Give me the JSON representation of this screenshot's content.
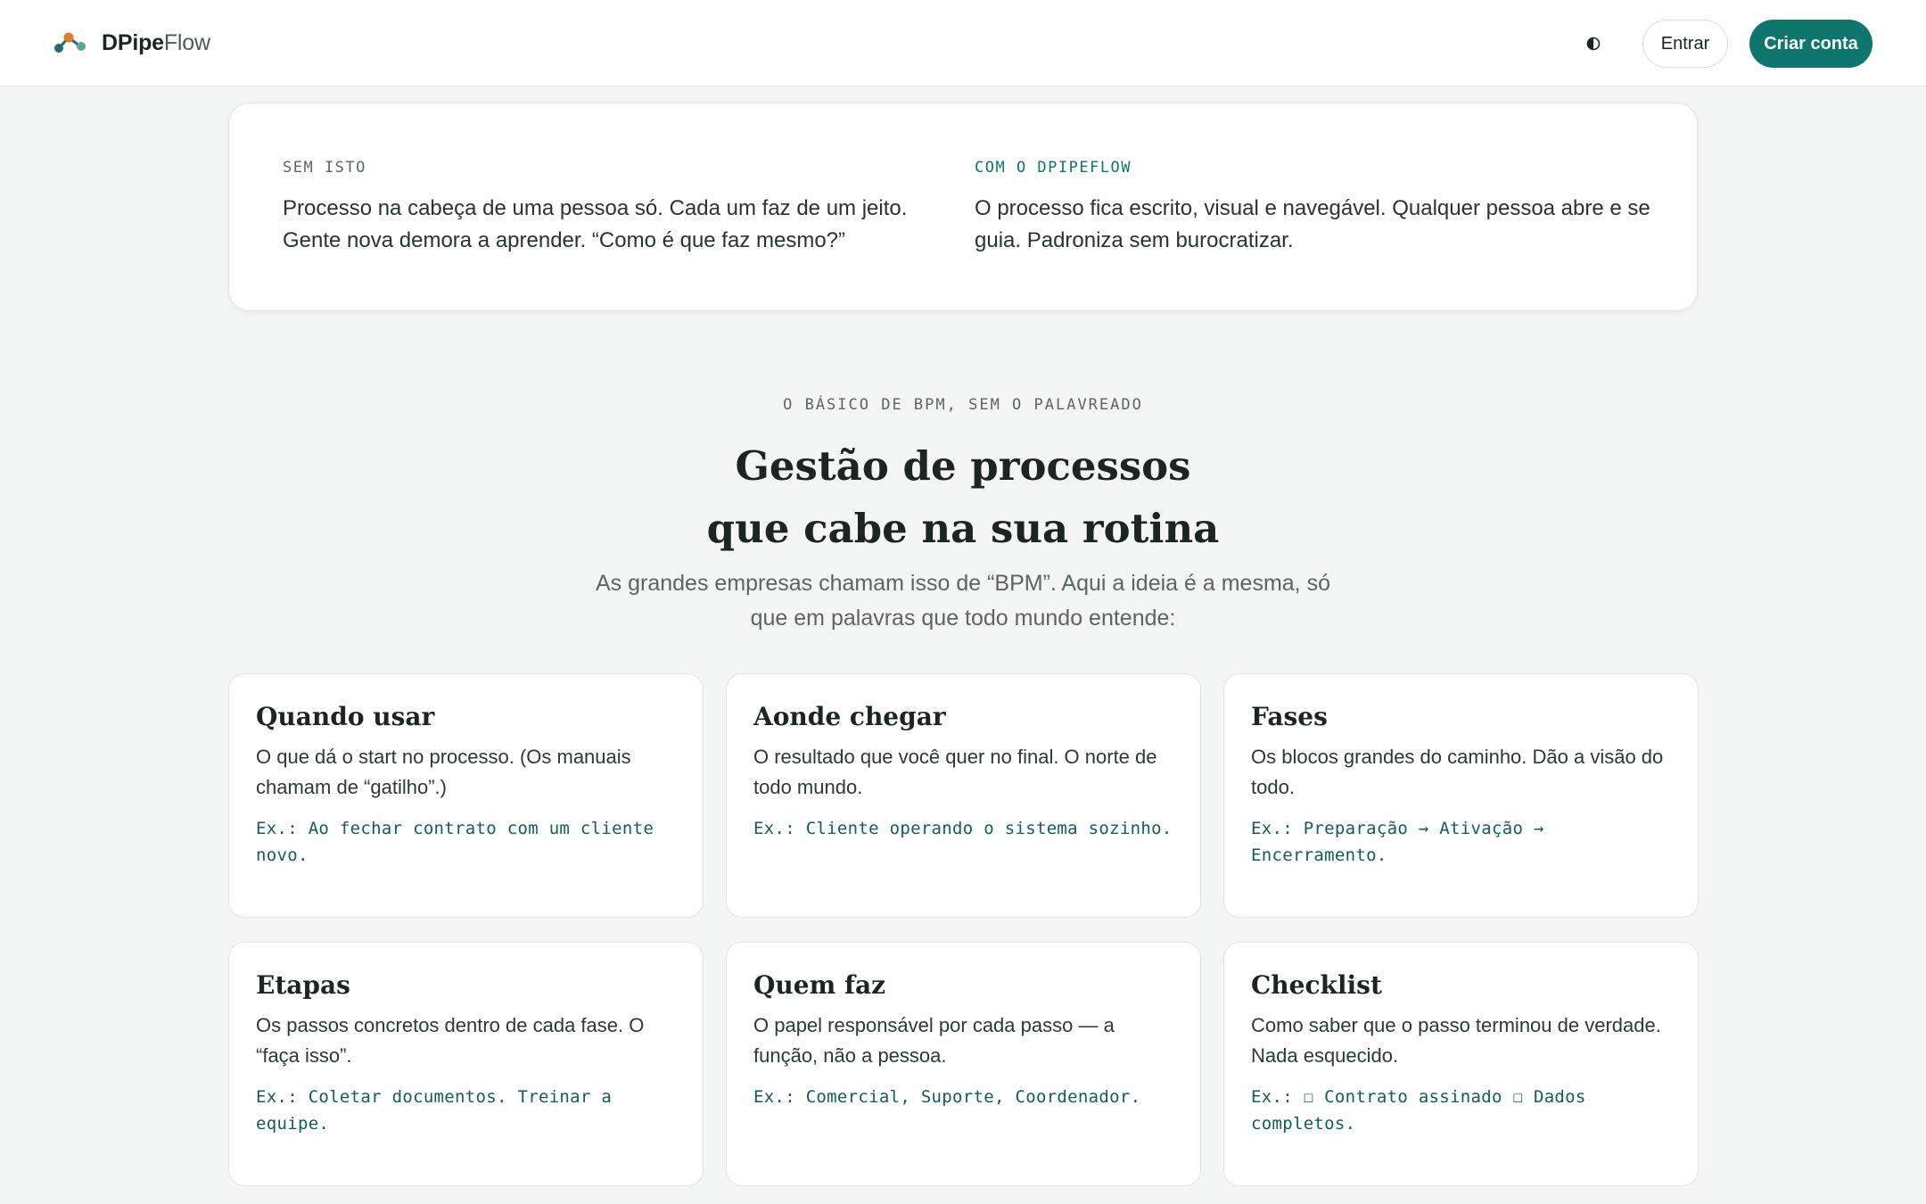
{
  "header": {
    "brand_strong": "DPipe",
    "brand_light": "Flow",
    "login_label": "Entrar",
    "signup_label": "Criar conta",
    "theme_icon": "contrast-icon",
    "colors": {
      "accent": "#0f766e",
      "logo_orange": "#e07a2f",
      "logo_teal": "#1f6f6a"
    }
  },
  "compare": {
    "without": {
      "label": "SEM ISTO",
      "text": "Processo na cabeça de uma pessoa só. Cada um faz de um jeito. Gente nova demora a aprender. “Como é que faz mesmo?”"
    },
    "with": {
      "label": "COM O DPIPEFLOW",
      "text": "O processo fica escrito, visual e navegável. Qualquer pessoa abre e se guia. Padroniza sem burocratizar."
    }
  },
  "section": {
    "eyebrow": "O BÁSICO DE BPM, SEM O PALAVREADO",
    "title": "Gestão de processos que cabe na sua rotina",
    "subtitle": "As grandes empresas chamam isso de “BPM”. Aqui a ideia é a mesma, só que em palavras que todo mundo entende:"
  },
  "cards": [
    {
      "title": "Quando usar",
      "desc": "O que dá o start no processo. (Os manuais chamam de “gatilho”.)",
      "example": "Ex.: Ao fechar contrato com um cliente novo."
    },
    {
      "title": "Aonde chegar",
      "desc": "O resultado que você quer no final. O norte de todo mundo.",
      "example": "Ex.: Cliente operando o sistema sozinho."
    },
    {
      "title": "Fases",
      "desc": "Os blocos grandes do caminho. Dão a visão do todo.",
      "example": "Ex.: Preparação → Ativação → Encerramento."
    },
    {
      "title": "Etapas",
      "desc": "Os passos concretos dentro de cada fase. O “faça isso”.",
      "example": "Ex.: Coletar documentos. Treinar a equipe."
    },
    {
      "title": "Quem faz",
      "desc": "O papel responsável por cada passo — a função, não a pessoa.",
      "example": "Ex.: Comercial, Suporte, Coordenador."
    },
    {
      "title": "Checklist",
      "desc": "Como saber que o passo terminou de verdade. Nada esquecido.",
      "example": "Ex.: ☐ Contrato assinado ☐ Dados completos."
    }
  ]
}
